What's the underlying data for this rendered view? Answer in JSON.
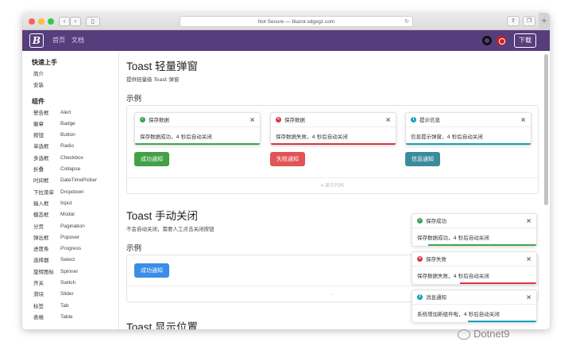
{
  "browser": {
    "url": "Not Secure — blazor.sdgxgz.com",
    "back_icon": "chevron-left",
    "forward_icon": "chevron-right"
  },
  "appbar": {
    "logo": "B",
    "nav": [
      "首页",
      "文档"
    ],
    "download": "下载"
  },
  "sidebar": {
    "sections": [
      {
        "title": "快速上手",
        "items": [
          {
            "cn": "简介",
            "en": ""
          },
          {
            "cn": "安装",
            "en": ""
          }
        ]
      },
      {
        "title": "组件",
        "items": [
          {
            "cn": "警告框",
            "en": "Alert"
          },
          {
            "cn": "徽章",
            "en": "Badge"
          },
          {
            "cn": "按钮",
            "en": "Button"
          },
          {
            "cn": "单选框",
            "en": "Radio"
          },
          {
            "cn": "多选框",
            "en": "Checkbox"
          },
          {
            "cn": "折叠",
            "en": "Collapse"
          },
          {
            "cn": "时间框",
            "en": "DateTimePicker"
          },
          {
            "cn": "下拉菜单",
            "en": "Dropdown"
          },
          {
            "cn": "输入框",
            "en": "Input"
          },
          {
            "cn": "模态框",
            "en": "Modal"
          },
          {
            "cn": "分页",
            "en": "Pagination"
          },
          {
            "cn": "弹出框",
            "en": "Popover"
          },
          {
            "cn": "进度条",
            "en": "Progress"
          },
          {
            "cn": "选择器",
            "en": "Select"
          },
          {
            "cn": "旋转图标",
            "en": "Spinner"
          },
          {
            "cn": "开关",
            "en": "Switch"
          },
          {
            "cn": "滑块",
            "en": "Slider"
          },
          {
            "cn": "标签",
            "en": "Tab"
          },
          {
            "cn": "表格",
            "en": "Table"
          }
        ]
      }
    ]
  },
  "section1": {
    "title": "Toast 轻量弹窗",
    "desc": "提供轻量级 Toast 弹窗",
    "example": "示例",
    "toasts": [
      {
        "title": "保存数据",
        "body": "保存数据成功，4 秒后自动关闭",
        "color": "#3fa64f"
      },
      {
        "title": "保存数据",
        "body": "保存数据失败，4 秒后自动关闭",
        "color": "#dc3545"
      },
      {
        "title": "提示信息",
        "body": "信息提示弹窗，4 秒后自动关闭",
        "color": "#17a2b8"
      }
    ],
    "buttons": [
      {
        "label": "成功通知",
        "color": "#43a047"
      },
      {
        "label": "失败通知",
        "color": "#e25353"
      },
      {
        "label": "信息通知",
        "color": "#3b8c9b"
      }
    ],
    "footer": "显示代码"
  },
  "section2": {
    "title": "Toast 手动关闭",
    "desc": "不会自动关闭，需要人工点击关闭按钮",
    "example": "示例",
    "button": "成功通知",
    "footer": "⌄"
  },
  "section3": {
    "title": "Toast 显示位置"
  },
  "floating_toasts": [
    {
      "title": "保存成功",
      "body": "保存数据成功，4 秒后自动关闭",
      "color": "#3fa64f"
    },
    {
      "title": "保存失败",
      "body": "保存数据失败，4 秒后自动关闭",
      "color": "#dc3545"
    },
    {
      "title": "消息通知",
      "body": "系统增加新组件啦，4 秒后自动关闭",
      "color": "#17a2b8"
    }
  ],
  "watermark": "Dotnet9"
}
